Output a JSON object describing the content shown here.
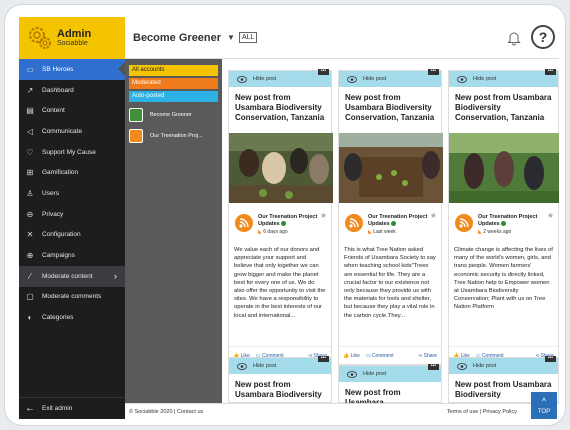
{
  "brand": {
    "title": "Admin",
    "subtitle": "Sociabble"
  },
  "header": {
    "page_name": "Become Greener",
    "all_label": "ALL",
    "help_label": "?"
  },
  "sidebar": {
    "items": [
      {
        "label": "SB Heroes",
        "icon": "heroes-icon"
      },
      {
        "label": "Dashboard",
        "icon": "chart-icon"
      },
      {
        "label": "Content",
        "icon": "content-icon"
      },
      {
        "label": "Communicate",
        "icon": "megaphone-icon"
      },
      {
        "label": "Support My Cause",
        "icon": "hands-icon"
      },
      {
        "label": "Gamification",
        "icon": "gamepad-icon"
      },
      {
        "label": "Users",
        "icon": "users-icon"
      },
      {
        "label": "Privacy",
        "icon": "privacy-icon"
      },
      {
        "label": "Configuration",
        "icon": "tools-icon"
      },
      {
        "label": "Campaigns",
        "icon": "globe-icon"
      },
      {
        "label": "Moderate content",
        "icon": "moderate-icon"
      },
      {
        "label": "Moderate comments",
        "icon": "comments-icon"
      },
      {
        "label": "Categories",
        "icon": "categories-icon"
      }
    ],
    "exit_label": "Exit admin"
  },
  "filters": {
    "all_accounts": "All accounts",
    "moderated": "Moderated",
    "auto_posted": "Auto-posted",
    "sources": [
      "Become Greener",
      "Our Treenation Proj..."
    ]
  },
  "footer": {
    "copyright": "© Sociabble 2020 | Contact us",
    "legal": "Terms of use | Privacy Policy"
  },
  "top_button": "TOP",
  "cards": [
    {
      "hide_label": "Hide post",
      "dots": "•••",
      "title": "New post from Usambara Biodiversity Conservation, Tanzania",
      "author": "Our Treenation Project Updates",
      "time": "6 days ago",
      "body": "We value each of our donors and appreciate your support and believe that only together we can grow bigger and make the planet best for every one of us. We do also offer the opportunity to visit the sites. We have a responsibility to operate in the best interests of our local and international...",
      "like": "Like",
      "comment": "Comment",
      "share": "Share"
    },
    {
      "hide_label": "Hide post",
      "dots": "•••",
      "title": "New post from Usambara Biodiversity Conservation, Tanzania",
      "author": "Our Treenation Project Updates",
      "time": "Last week",
      "body": "This is what Tree Nation asked Friends of Usambara Society to say when teaching school kids\"Trees are essential for life. They are a crucial factor to our existence not only because they provide us with the materials for tools and shelter, but because they play a vital role in the carbon cycle.They...",
      "like": "Like",
      "comment": "Comment",
      "share": "Share"
    },
    {
      "hide_label": "Hide post",
      "dots": "•••",
      "title": "New post from Usambara Biodiversity Conservation, Tanzania",
      "author": "Our Treenation Project Updates",
      "time": "2 weeks ago",
      "body": "Climate change is affecting the lives of many of the world's women, girls, and trans people. Women farmers' economic security is directly linked, Tree Nation help to Empower women at Usambara Biodiversity Conservation; Plant with us on Tree Nation Platform",
      "like": "Like",
      "comment": "Comment",
      "share": "Share"
    }
  ],
  "cards_row2": [
    {
      "hide_label": "Hide post",
      "dots": "•••",
      "title": "New post from Usambara Biodiversity"
    },
    {
      "hide_label": "Hide post",
      "dots": "•••",
      "title": "New post from Usambara"
    },
    {
      "hide_label": "Hide post",
      "dots": "•••",
      "title": "New post from Usambara Biodiversity"
    }
  ],
  "colors": {
    "brand_yellow": "#f5c400",
    "active_blue": "#2e6fd0",
    "hide_bar": "#a5dcec",
    "rss_orange": "#f08a1c"
  }
}
